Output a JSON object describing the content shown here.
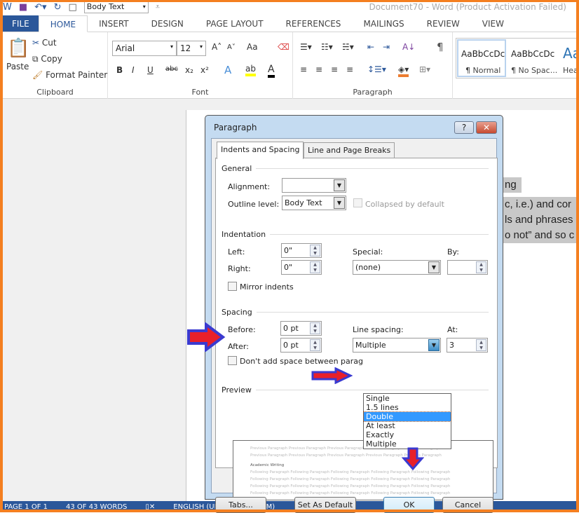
{
  "window": {
    "title": "Document70 - Word (Product Activation Failed)",
    "style_box": "Body Text"
  },
  "tabs": [
    "FILE",
    "HOME",
    "INSERT",
    "DESIGN",
    "PAGE LAYOUT",
    "REFERENCES",
    "MAILINGS",
    "REVIEW",
    "VIEW"
  ],
  "active_tab": "HOME",
  "ribbon": {
    "clipboard": {
      "label": "Clipboard",
      "paste": "Paste",
      "cut": "Cut",
      "copy": "Copy",
      "format_painter": "Format Painter"
    },
    "font": {
      "label": "Font",
      "font_name": "Arial",
      "font_size": "12",
      "change_case": "Aa",
      "bold": "B",
      "italic": "I",
      "underline": "U",
      "strike": "abc",
      "sub": "x₂",
      "sup": "x²"
    },
    "paragraph": {
      "label": "Paragraph"
    },
    "styles": [
      {
        "preview": "AaBbCcDc",
        "name": "¶ Normal"
      },
      {
        "preview": "AaBbCcDc",
        "name": "¶ No Spac..."
      },
      {
        "preview": "Aa",
        "name": "Hea"
      }
    ]
  },
  "document": {
    "lines": [
      "ng",
      "c, i.e.) and cor",
      "ls and phrases",
      "o not” and so c"
    ]
  },
  "status": {
    "page": "PAGE 1 OF 1",
    "words": "43 OF 43 WORDS",
    "language": "ENGLISH (UNITED KINGDOM)"
  },
  "dialog": {
    "title": "Paragraph",
    "help": "?",
    "close": "✕",
    "tabs": [
      "Indents and Spacing",
      "Line and Page Breaks"
    ],
    "general": {
      "heading": "General",
      "alignment_label": "Alignment:",
      "alignment_value": "",
      "outline_label": "Outline level:",
      "outline_value": "Body Text",
      "collapsed_label": "Collapsed by default"
    },
    "indentation": {
      "heading": "Indentation",
      "left_label": "Left:",
      "left_value": "0\"",
      "right_label": "Right:",
      "right_value": "0\"",
      "special_label": "Special:",
      "special_value": "(none)",
      "by_label": "By:",
      "by_value": "",
      "mirror_label": "Mirror indents"
    },
    "spacing": {
      "heading": "Spacing",
      "before_label": "Before:",
      "before_value": "0 pt",
      "after_label": "After:",
      "after_value": "0 pt",
      "line_label": "Line spacing:",
      "line_value": "Multiple",
      "at_label": "At:",
      "at_value": "3",
      "dont_add_label": "Don't add space between parag",
      "options": [
        "Single",
        "1.5 lines",
        "Double",
        "At least",
        "Exactly",
        "Multiple"
      ],
      "highlighted": "Double"
    },
    "preview": {
      "heading": "Preview",
      "previous": "Previous Paragraph Previous Paragraph Previous Paragraph Previous Paragraph Previous Paragraph",
      "current": "Academic Writing",
      "following": "Following Paragraph Following Paragraph Following Paragraph Following Paragraph Following Paragraph"
    },
    "buttons": {
      "tabs": "Tabs...",
      "set_default": "Set As Default",
      "ok": "OK",
      "cancel": "Cancel"
    }
  },
  "colors": {
    "accent": "#2b579a",
    "frame": "#f47f20",
    "arrow_fill": "#e8202a",
    "arrow_outline": "#3a3ad0",
    "highlight": "#3399ff"
  }
}
